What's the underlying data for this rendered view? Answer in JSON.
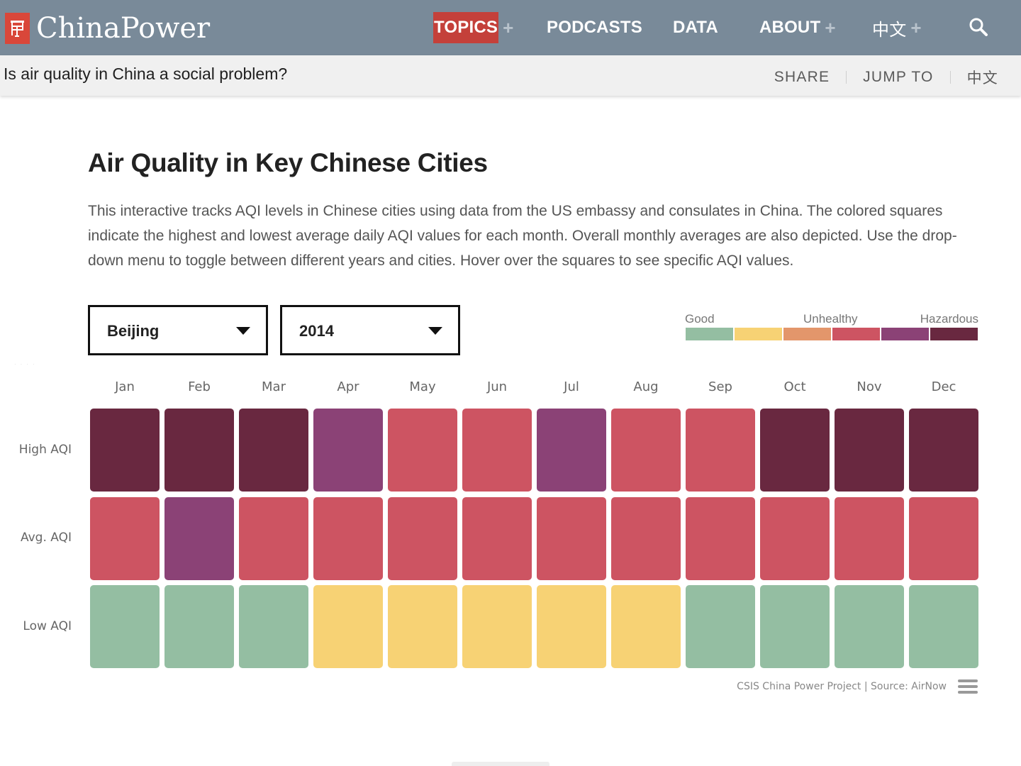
{
  "header": {
    "logo_text": "ChinaPower",
    "logo_color": "#d9473a",
    "bar_color": "#798a99",
    "nav": [
      {
        "label": "TOPICS",
        "has_plus": true,
        "active": true
      },
      {
        "label": "PODCASTS",
        "has_plus": false,
        "active": false
      },
      {
        "label": "DATA",
        "has_plus": false,
        "active": false
      },
      {
        "label": "ABOUT",
        "has_plus": true,
        "active": false
      },
      {
        "label": "中文",
        "has_plus": true,
        "active": false
      }
    ],
    "plus_glyph": "+",
    "search_icon": "search-icon"
  },
  "subbar": {
    "title": "Is air quality in China a social problem?",
    "links": [
      "SHARE",
      "JUMP TO",
      "中文"
    ]
  },
  "main": {
    "title": "Air Quality in Key Chinese Cities",
    "description": "This interactive tracks AQI levels in Chinese cities using data from the US embassy and consulates in China. The colored squares indicate the highest and lowest average daily AQI values for each month. Overall monthly averages are also depicted. Use the drop-down menu to toggle between different years and cities. Hover over the squares to see specific AQI values.",
    "city_select": {
      "value": "Beijing"
    },
    "year_select": {
      "value": "2014"
    }
  },
  "chart_data": {
    "type": "heatmap",
    "title": "Air Quality in Key Chinese Cities",
    "city": "Beijing",
    "year": "2014",
    "categories": [
      "Jan",
      "Feb",
      "Mar",
      "Apr",
      "May",
      "Jun",
      "Jul",
      "Aug",
      "Sep",
      "Oct",
      "Nov",
      "Dec"
    ],
    "rows": [
      "High AQI",
      "Avg. AQI",
      "Low AQI"
    ],
    "legend": {
      "labels": [
        {
          "text": "Good",
          "position": "left"
        },
        {
          "text": "Unhealthy",
          "position": "center"
        },
        {
          "text": "Hazardous",
          "position": "right"
        }
      ],
      "levels": [
        "Good",
        "Moderate",
        "Unhealthy for Sensitive Groups",
        "Unhealthy",
        "Very Unhealthy",
        "Hazardous"
      ],
      "colors": [
        "#94bea2",
        "#f7d274",
        "#e3966b",
        "#cd5462",
        "#8b4276",
        "#692840"
      ]
    },
    "values": [
      [
        "Hazardous",
        "Hazardous",
        "Hazardous",
        "Very Unhealthy",
        "Unhealthy",
        "Unhealthy",
        "Very Unhealthy",
        "Unhealthy",
        "Unhealthy",
        "Hazardous",
        "Hazardous",
        "Hazardous"
      ],
      [
        "Unhealthy",
        "Very Unhealthy",
        "Unhealthy",
        "Unhealthy",
        "Unhealthy",
        "Unhealthy",
        "Unhealthy",
        "Unhealthy",
        "Unhealthy",
        "Unhealthy",
        "Unhealthy",
        "Unhealthy"
      ],
      [
        "Good",
        "Good",
        "Good",
        "Moderate",
        "Moderate",
        "Moderate",
        "Moderate",
        "Moderate",
        "Good",
        "Good",
        "Good",
        "Good"
      ]
    ],
    "credit": "CSIS China Power Project | Source: AirNow"
  }
}
